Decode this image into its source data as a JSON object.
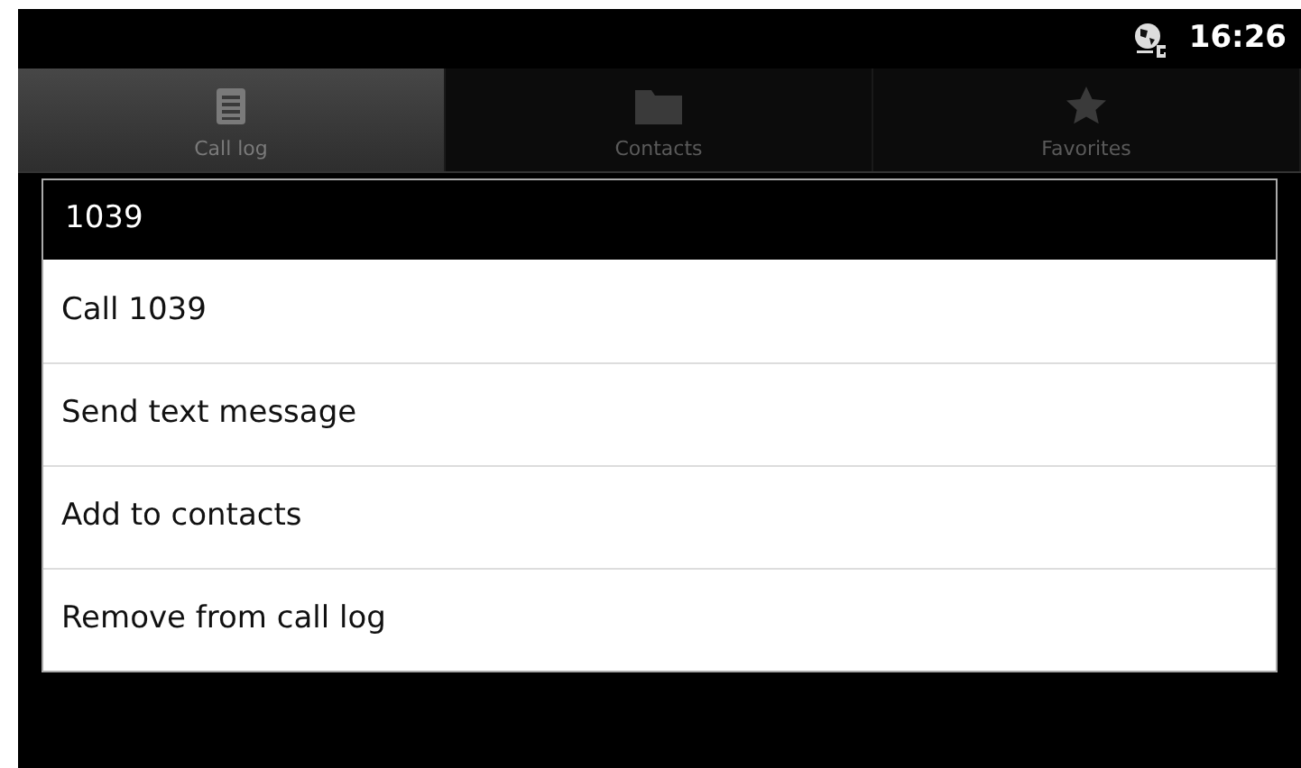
{
  "status_bar": {
    "time": "16:26"
  },
  "tabs": [
    {
      "label": "Call log",
      "kind": "list",
      "selected": true
    },
    {
      "label": "Contacts",
      "kind": "folder",
      "selected": false
    },
    {
      "label": "Favorites",
      "kind": "star",
      "selected": false
    }
  ],
  "dialog": {
    "title": "1039",
    "items": [
      "Call 1039",
      "Send text message",
      "Add to contacts",
      "Remove from call log"
    ]
  }
}
